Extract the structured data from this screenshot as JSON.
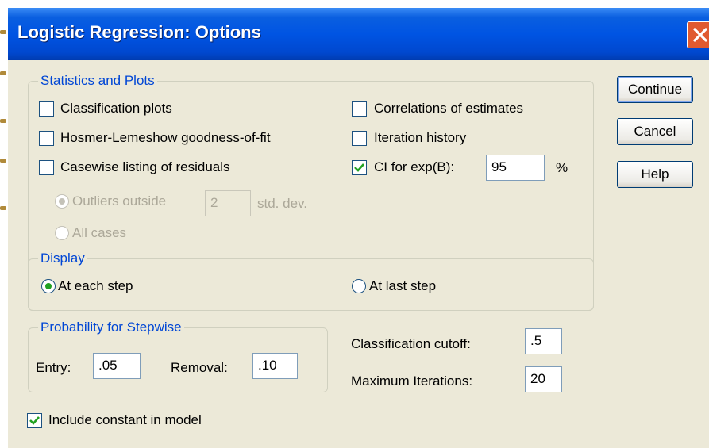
{
  "window": {
    "title": "Logistic Regression: Options"
  },
  "buttons": {
    "continue": "Continue",
    "cancel": "Cancel",
    "help": "Help"
  },
  "statistics_and_plots": {
    "legend": "Statistics and Plots",
    "classification_plots": {
      "label": "Classification plots",
      "checked": false
    },
    "hosmer_lemeshow": {
      "label": "Hosmer-Lemeshow goodness-of-fit",
      "checked": false
    },
    "casewise_listing": {
      "label": "Casewise listing of residuals",
      "checked": false
    },
    "outliers_outside": {
      "label": "Outliers outside",
      "value": "2",
      "unit": "std. dev.",
      "selected": true,
      "enabled": false
    },
    "all_cases": {
      "label": "All cases",
      "selected": false,
      "enabled": false
    },
    "correlations": {
      "label": "Correlations of estimates",
      "checked": false
    },
    "iteration_history": {
      "label": "Iteration history",
      "checked": false
    },
    "ci_expb": {
      "label": "CI for exp(B):",
      "value": "95",
      "unit": "%",
      "checked": true
    }
  },
  "display": {
    "legend": "Display",
    "at_each_step": {
      "label": "At each step",
      "selected": true
    },
    "at_last_step": {
      "label": "At last step",
      "selected": false
    }
  },
  "probability_stepwise": {
    "legend": "Probability for Stepwise",
    "entry_label": "Entry:",
    "entry_value": ".05",
    "removal_label": "Removal:",
    "removal_value": ".10"
  },
  "classification_cutoff": {
    "label": "Classification cutoff:",
    "value": ".5"
  },
  "maximum_iterations": {
    "label": "Maximum Iterations:",
    "value": "20"
  },
  "include_constant": {
    "label": "Include constant in model",
    "checked": true
  },
  "colors": {
    "title_bar": "#0054e3",
    "group_label": "#0046d5",
    "dialog_bg": "#ece9d8",
    "check_mark": "#21a121",
    "close_button": "#e05a30"
  }
}
